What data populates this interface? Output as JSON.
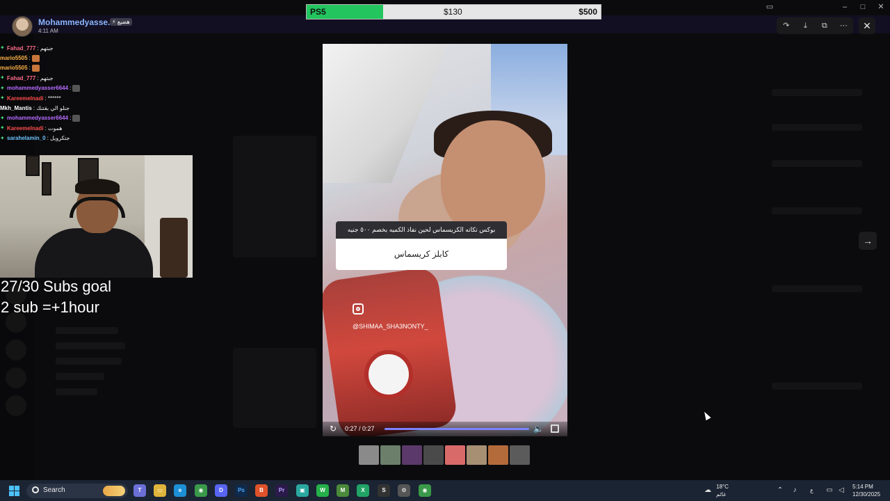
{
  "user": {
    "name": "Mohammedyasse...",
    "tag": "⚡ هضيع",
    "time": "4:11 AM"
  },
  "goal_bar": {
    "left_label": "PS5",
    "mid_label": "$130",
    "right_label": "$500",
    "progress": 0.26,
    "fill_color": "#22c55e"
  },
  "chat": [
    {
      "name": "Fahad_777",
      "msg": ": جبتهم",
      "color": "#ff6b8a",
      "badge": true,
      "emote": null
    },
    {
      "name": "mario5505",
      "msg": ":",
      "color": "#ffb347",
      "badge": false,
      "emote": "orange"
    },
    {
      "name": "mario5505",
      "msg": ":",
      "color": "#ffb347",
      "badge": false,
      "emote": "orange"
    },
    {
      "name": "Fahad_777",
      "msg": ": جبتهم",
      "color": "#ff6b8a",
      "badge": true,
      "emote": null
    },
    {
      "name": "mohammedyasser6644",
      "msg": ":",
      "color": "#b76bff",
      "badge": true,
      "emote": "dark"
    },
    {
      "name": "Kareemelnadi",
      "msg": ": ******",
      "color": "#ff4d4d",
      "badge": true,
      "emote": null
    },
    {
      "name": "Mkh_Mantis",
      "msg": ": جنلو الي بقتنك",
      "color": "#ffffff",
      "badge": false,
      "emote": null
    },
    {
      "name": "mohammedyasser6644",
      "msg": ":",
      "color": "#b76bff",
      "badge": true,
      "emote": "dark"
    },
    {
      "name": "Kareemelnadi",
      "msg": ": هموت",
      "color": "#ff4d4d",
      "badge": true,
      "emote": null
    },
    {
      "name": "sarahelamin_0",
      "msg": ": جتكرويل",
      "color": "#6ec3ff",
      "badge": true,
      "emote": null
    }
  ],
  "stream_goal": {
    "line1": "27/30 Subs goal",
    "line2": "2 sub =+1hour"
  },
  "video": {
    "card_header": "بوكس تكاته الكريسماس لحين نفاذ الكميه بخصم ٥٠٠ جنيه",
    "card_body": "كابلز كريسماس",
    "ig_handle": "@SHIMAA_SHA3NONTY_",
    "time": "0:27 / 0:27",
    "progress": 1.0
  },
  "thumbnails": [
    "#8a8a8a",
    "#6b7f6a",
    "#5b3a6b",
    "#4a4a4a",
    "#d96a6a",
    "#a78f74",
    "#b36b3b",
    "#5b5b5b"
  ],
  "taskbar": {
    "search_label": "Search",
    "weather_temp": "18°C",
    "weather_label": "غائم",
    "clock_time": "5:14 PM",
    "clock_date": "12/30/2025",
    "lang": "ع"
  },
  "icons": {
    "forward": "forward-icon",
    "download": "download-icon",
    "open": "open-external-icon",
    "more": "more-icon",
    "close": "close-icon",
    "next": "arrow-right-icon"
  }
}
